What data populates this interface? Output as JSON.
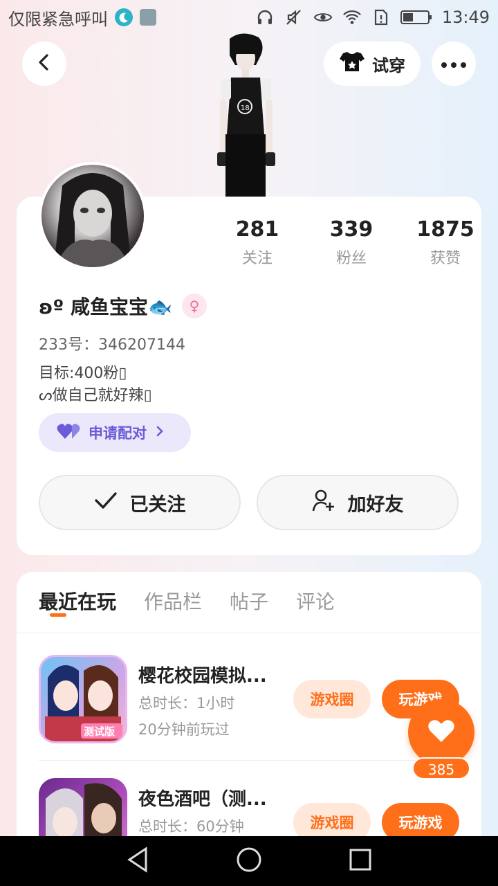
{
  "status_bar": {
    "carrier": "仅限紧急呼叫",
    "time": "13:49"
  },
  "header": {
    "try_on_label": "试穿",
    "icons": [
      "back-icon",
      "tshirt-icon",
      "more-icon"
    ]
  },
  "profile": {
    "stats": [
      {
        "value": "281",
        "label": "关注"
      },
      {
        "value": "339",
        "label": "粉丝"
      },
      {
        "value": "1875",
        "label": "获赞"
      }
    ],
    "name": "ʚº 咸鱼宝宝🐟",
    "gender": "♀",
    "uid": "233号：346207144",
    "bio_line1": "目标:400粉▯",
    "bio_line2": "ᔕ做自己就好辣▯",
    "pair_label": "申请配对",
    "followed_label": "已关注",
    "add_friend_label": "加好友"
  },
  "tabs": [
    {
      "label": "最近在玩",
      "active": true
    },
    {
      "label": "作品栏",
      "active": false
    },
    {
      "label": "帖子",
      "active": false
    },
    {
      "label": "评论",
      "active": false
    }
  ],
  "games": [
    {
      "title": "樱花校园模拟...",
      "duration": "总时长：1小时",
      "last_played": "20分钟前玩过",
      "icon_badge": "测试版",
      "circle_label": "游戏圈",
      "play_label": "玩游戏"
    },
    {
      "title": "夜色酒吧（测...",
      "duration": "总时长：60分钟",
      "last_played": "",
      "circle_label": "游戏圈",
      "play_label": "玩游戏"
    }
  ],
  "like_float": {
    "count": "385"
  },
  "colors": {
    "accent": "#ff6f1a",
    "pair": "#6a5bd8"
  }
}
